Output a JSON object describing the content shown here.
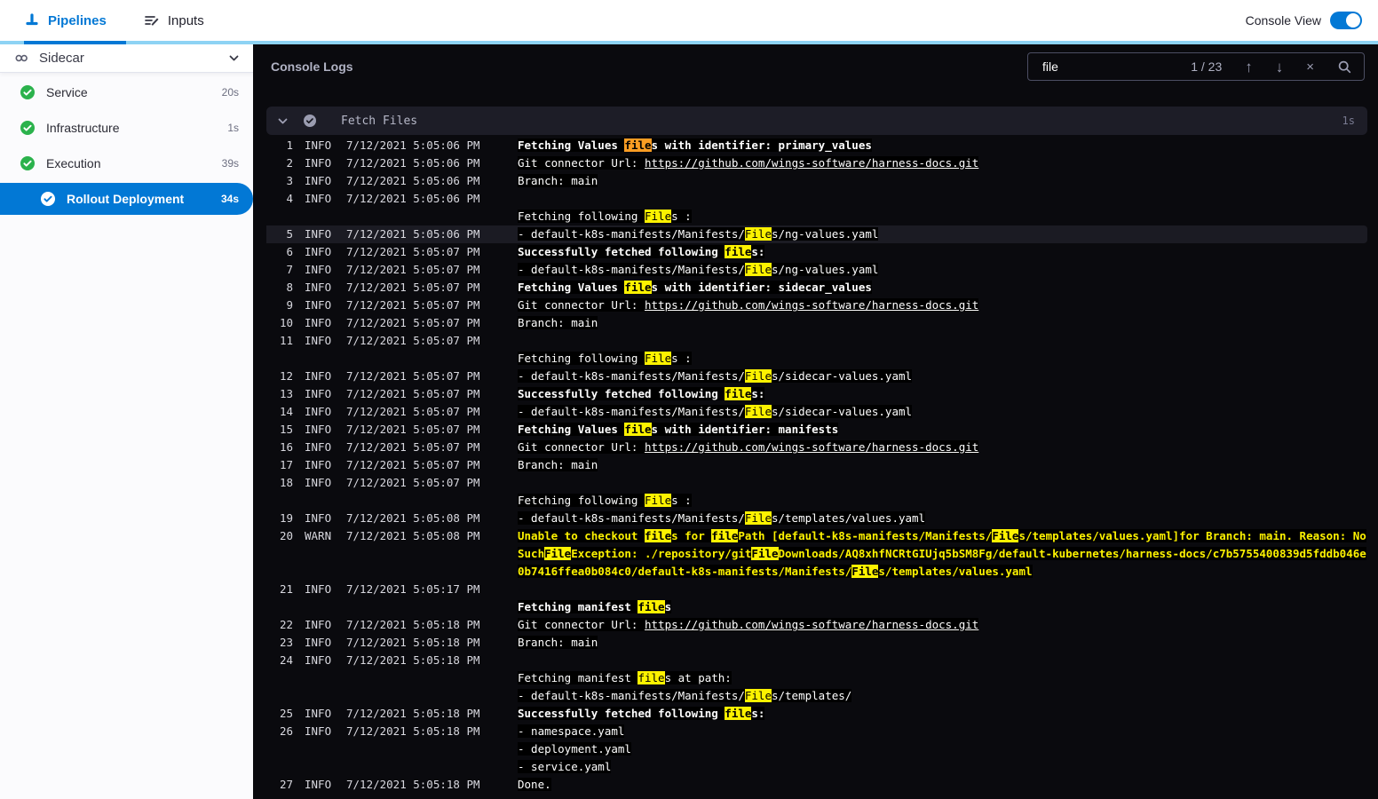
{
  "topbar": {
    "tabs": [
      {
        "label": "Pipelines",
        "active": true
      },
      {
        "label": "Inputs",
        "active": false
      }
    ],
    "console_view": {
      "label": "Console View",
      "enabled": true
    }
  },
  "sidebar": {
    "stage": {
      "label": "Sidecar"
    },
    "items": [
      {
        "label": "Service",
        "duration": "20s",
        "status": "success",
        "selected": false
      },
      {
        "label": "Infrastructure",
        "duration": "1s",
        "status": "success",
        "selected": false
      },
      {
        "label": "Execution",
        "duration": "39s",
        "status": "success",
        "selected": false
      },
      {
        "label": "Rollout Deployment",
        "duration": "34s",
        "status": "success",
        "selected": true
      }
    ]
  },
  "console": {
    "title": "Console Logs",
    "search": {
      "query": "file",
      "counter": "1 / 23"
    },
    "section": {
      "title": "Fetch Files",
      "duration": "1s"
    },
    "colors": {
      "accent": "#0278d5",
      "match_highlight": "#fdf200",
      "active_match_highlight": "#fb9d23",
      "warn_text": "#fdf200",
      "success_green": "#2bb24c"
    },
    "logs": [
      {
        "num": "1",
        "level": "INFO",
        "time": "7/12/2021 5:05:06 PM",
        "text": "Fetching Values files with identifier: primary_values",
        "bold": true
      },
      {
        "num": "2",
        "level": "INFO",
        "time": "7/12/2021 5:05:06 PM",
        "text": "Git connector Url: https://github.com/wings-software/harness-docs.git"
      },
      {
        "num": "3",
        "level": "INFO",
        "time": "7/12/2021 5:05:06 PM",
        "text": "Branch: main"
      },
      {
        "num": "4",
        "level": "INFO",
        "time": "7/12/2021 5:05:06 PM",
        "text": ""
      },
      {
        "text": "Fetching following Files :"
      },
      {
        "num": "5",
        "level": "INFO",
        "time": "7/12/2021 5:05:06 PM",
        "text": "- default-k8s-manifests/Manifests/Files/ng-values.yaml",
        "current": true
      },
      {
        "num": "6",
        "level": "INFO",
        "time": "7/12/2021 5:05:07 PM",
        "text": "Successfully fetched following files:",
        "bold": true
      },
      {
        "num": "7",
        "level": "INFO",
        "time": "7/12/2021 5:05:07 PM",
        "text": "- default-k8s-manifests/Manifests/Files/ng-values.yaml"
      },
      {
        "num": "8",
        "level": "INFO",
        "time": "7/12/2021 5:05:07 PM",
        "text": "Fetching Values files with identifier: sidecar_values",
        "bold": true
      },
      {
        "num": "9",
        "level": "INFO",
        "time": "7/12/2021 5:05:07 PM",
        "text": "Git connector Url: https://github.com/wings-software/harness-docs.git"
      },
      {
        "num": "10",
        "level": "INFO",
        "time": "7/12/2021 5:05:07 PM",
        "text": "Branch: main"
      },
      {
        "num": "11",
        "level": "INFO",
        "time": "7/12/2021 5:05:07 PM",
        "text": ""
      },
      {
        "text": "Fetching following Files :"
      },
      {
        "num": "12",
        "level": "INFO",
        "time": "7/12/2021 5:05:07 PM",
        "text": "- default-k8s-manifests/Manifests/Files/sidecar-values.yaml"
      },
      {
        "num": "13",
        "level": "INFO",
        "time": "7/12/2021 5:05:07 PM",
        "text": "Successfully fetched following files:",
        "bold": true
      },
      {
        "num": "14",
        "level": "INFO",
        "time": "7/12/2021 5:05:07 PM",
        "text": "- default-k8s-manifests/Manifests/Files/sidecar-values.yaml"
      },
      {
        "num": "15",
        "level": "INFO",
        "time": "7/12/2021 5:05:07 PM",
        "text": "Fetching Values files with identifier: manifests",
        "bold": true
      },
      {
        "num": "16",
        "level": "INFO",
        "time": "7/12/2021 5:05:07 PM",
        "text": "Git connector Url: https://github.com/wings-software/harness-docs.git"
      },
      {
        "num": "17",
        "level": "INFO",
        "time": "7/12/2021 5:05:07 PM",
        "text": "Branch: main"
      },
      {
        "num": "18",
        "level": "INFO",
        "time": "7/12/2021 5:05:07 PM",
        "text": ""
      },
      {
        "text": "Fetching following Files :"
      },
      {
        "num": "19",
        "level": "INFO",
        "time": "7/12/2021 5:05:08 PM",
        "text": "- default-k8s-manifests/Manifests/Files/templates/values.yaml"
      },
      {
        "num": "20",
        "level": "WARN",
        "time": "7/12/2021 5:05:08 PM",
        "text": "Unable to checkout files for filePath [default-k8s-manifests/Manifests/Files/templates/values.yaml]for Branch: main. Reason: NoSuchFileException: ./repository/gitFileDownloads/AQ8xhfNCRtGIUjq5bSM8Fg/default-kubernetes/harness-docs/c7b5755400839d5fddb046e0b7416ffea0b084c0/default-k8s-manifests/Manifests/Files/templates/values.yaml"
      },
      {
        "num": "21",
        "level": "INFO",
        "time": "7/12/2021 5:05:17 PM",
        "text": ""
      },
      {
        "text": "Fetching manifest files",
        "bold": true
      },
      {
        "num": "22",
        "level": "INFO",
        "time": "7/12/2021 5:05:18 PM",
        "text": "Git connector Url: https://github.com/wings-software/harness-docs.git"
      },
      {
        "num": "23",
        "level": "INFO",
        "time": "7/12/2021 5:05:18 PM",
        "text": "Branch: main"
      },
      {
        "num": "24",
        "level": "INFO",
        "time": "7/12/2021 5:05:18 PM",
        "text": ""
      },
      {
        "text": "Fetching manifest files at path:"
      },
      {
        "text": "- default-k8s-manifests/Manifests/Files/templates/"
      },
      {
        "num": "25",
        "level": "INFO",
        "time": "7/12/2021 5:05:18 PM",
        "text": "Successfully fetched following files:",
        "bold": true
      },
      {
        "num": "26",
        "level": "INFO",
        "time": "7/12/2021 5:05:18 PM",
        "text": "- namespace.yaml"
      },
      {
        "text": "- deployment.yaml"
      },
      {
        "text": "- service.yaml"
      },
      {
        "num": "27",
        "level": "INFO",
        "time": "7/12/2021 5:05:18 PM",
        "text": "Done."
      }
    ]
  }
}
